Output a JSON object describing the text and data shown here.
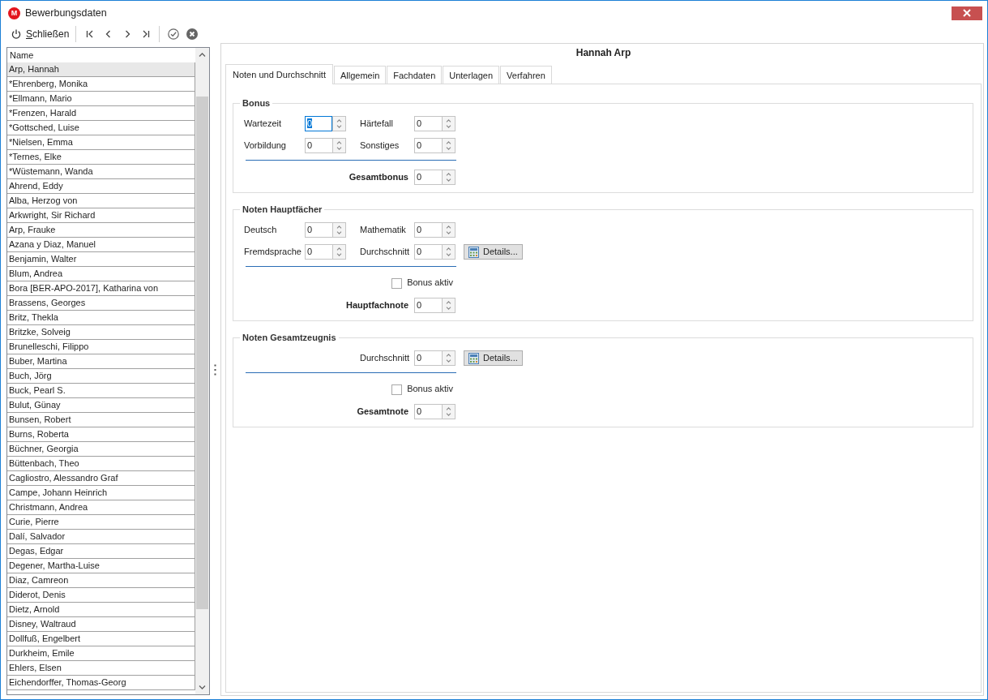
{
  "window": {
    "logo_letter": "M",
    "title": "Bewerbungsdaten"
  },
  "toolbar": {
    "close_label": "Schließen"
  },
  "list": {
    "header": "Name",
    "rows": [
      {
        "name": "Arp, Hannah",
        "selected": true
      },
      {
        "name": "*Ehrenberg, Monika",
        "selected": false
      },
      {
        "name": "*Ellmann, Mario",
        "selected": false
      },
      {
        "name": "*Frenzen, Harald",
        "selected": false
      },
      {
        "name": "*Gottsched, Luise",
        "selected": false
      },
      {
        "name": "*Nielsen, Emma",
        "selected": false
      },
      {
        "name": "*Ternes, Elke",
        "selected": false
      },
      {
        "name": "*Wüstemann, Wanda",
        "selected": false
      },
      {
        "name": "Ahrend, Eddy",
        "selected": false
      },
      {
        "name": "Alba, Herzog von",
        "selected": false
      },
      {
        "name": "Arkwright, Sir Richard",
        "selected": false
      },
      {
        "name": "Arp, Frauke",
        "selected": false
      },
      {
        "name": "Azana y Diaz, Manuel",
        "selected": false
      },
      {
        "name": "Benjamin, Walter",
        "selected": false
      },
      {
        "name": "Blum, Andrea",
        "selected": false
      },
      {
        "name": "Bora [BER-APO-2017], Katharina von",
        "selected": false
      },
      {
        "name": "Brassens, Georges",
        "selected": false
      },
      {
        "name": "Britz, Thekla",
        "selected": false
      },
      {
        "name": "Britzke, Solveig",
        "selected": false
      },
      {
        "name": "Brunelleschi, Filippo",
        "selected": false
      },
      {
        "name": "Buber, Martina",
        "selected": false
      },
      {
        "name": "Buch, Jörg",
        "selected": false
      },
      {
        "name": "Buck, Pearl S.",
        "selected": false
      },
      {
        "name": "Bulut, Günay",
        "selected": false
      },
      {
        "name": "Bunsen, Robert",
        "selected": false
      },
      {
        "name": "Burns, Roberta",
        "selected": false
      },
      {
        "name": "Büchner, Georgia",
        "selected": false
      },
      {
        "name": "Büttenbach, Theo",
        "selected": false
      },
      {
        "name": "Cagliostro, Alessandro Graf",
        "selected": false
      },
      {
        "name": "Campe, Johann Heinrich",
        "selected": false
      },
      {
        "name": "Christmann, Andrea",
        "selected": false
      },
      {
        "name": "Curie, Pierre",
        "selected": false
      },
      {
        "name": "Dalí, Salvador",
        "selected": false
      },
      {
        "name": "Degas, Edgar",
        "selected": false
      },
      {
        "name": "Degener, Martha-Luise",
        "selected": false
      },
      {
        "name": "Diaz, Camreon",
        "selected": false
      },
      {
        "name": "Diderot, Denis",
        "selected": false
      },
      {
        "name": "Dietz, Arnold",
        "selected": false
      },
      {
        "name": "Disney, Waltraud",
        "selected": false
      },
      {
        "name": "Dollfuß, Engelbert",
        "selected": false
      },
      {
        "name": "Durkheim, Emile",
        "selected": false
      },
      {
        "name": "Ehlers, Elsen",
        "selected": false
      },
      {
        "name": "Eichendorffer, Thomas-Georg",
        "selected": false
      }
    ]
  },
  "detail": {
    "title": "Hannah Arp",
    "tabs": [
      {
        "label": "Noten und Durchschnitt",
        "selected": true
      },
      {
        "label": "Allgemein",
        "selected": false
      },
      {
        "label": "Fachdaten",
        "selected": false
      },
      {
        "label": "Unterlagen",
        "selected": false
      },
      {
        "label": "Verfahren",
        "selected": false
      }
    ],
    "groups": [
      {
        "title": "Bonus",
        "rows": [
          [
            {
              "kind": "spin",
              "label": "Wartezeit",
              "value": "0",
              "focused": true
            },
            {
              "kind": "spin",
              "label": "Härtefall",
              "value": "0",
              "focused": false
            }
          ],
          [
            {
              "kind": "spin",
              "label": "Vorbildung",
              "value": "0",
              "focused": false
            },
            {
              "kind": "spin",
              "label": "Sonstiges",
              "value": "0",
              "focused": false
            }
          ]
        ],
        "result": {
          "label": "Gesamtbonus",
          "value": "0",
          "focused": false
        }
      },
      {
        "title": "Noten Hauptfächer",
        "rows": [
          [
            {
              "kind": "spin",
              "label": "Deutsch",
              "value": "0",
              "focused": false
            },
            {
              "kind": "spin",
              "label": "Mathematik",
              "value": "0",
              "focused": false
            }
          ],
          [
            {
              "kind": "spin",
              "label": "Fremdsprache",
              "value": "0",
              "focused": false
            },
            {
              "kind": "spin",
              "label": "Durchschnitt",
              "value": "0",
              "focused": false
            },
            {
              "kind": "button",
              "label": "Details..."
            }
          ]
        ],
        "checkbox": {
          "label": "Bonus aktiv",
          "checked": false
        },
        "result": {
          "label": "Hauptfachnote",
          "value": "0",
          "focused": false
        }
      },
      {
        "title": "Noten Gesamtzeugnis",
        "rows": [
          [
            {
              "kind": "spin",
              "label": "Durchschnitt",
              "value": "0",
              "focused": false
            },
            {
              "kind": "button",
              "label": "Details..."
            }
          ]
        ],
        "checkbox": {
          "label": "Bonus aktiv",
          "checked": false
        },
        "result": {
          "label": "Gesamtnote",
          "value": "0",
          "focused": false
        }
      }
    ]
  }
}
